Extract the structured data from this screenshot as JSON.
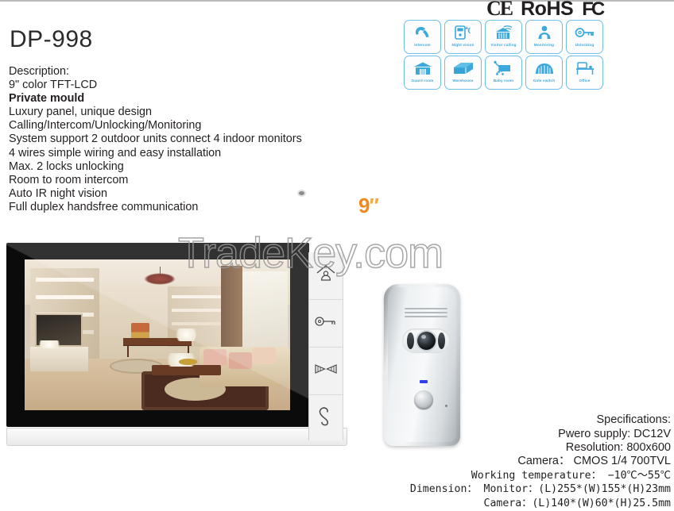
{
  "certifications": [
    {
      "name": "ce-mark",
      "label": "CΕ"
    },
    {
      "name": "rohs-mark",
      "label": "RoHS"
    },
    {
      "name": "fc-mark",
      "label": "FC"
    }
  ],
  "product": {
    "model": "DP-998",
    "size_badge_number": "9",
    "size_badge_unit": "″",
    "description_lines": [
      "Description:",
      "9\" color TFT-LCD",
      "Private mould",
      "Luxury panel, unique design",
      "Calling/Intercom/Unlocking/Monitoring",
      "System support 2 outdoor units connect 4 indoor monitors",
      "4 wires simple wiring and easy installation",
      "Max. 2 locks unlocking",
      "Room to room intercom",
      "Auto IR night vision",
      "Full duplex handsfree communication"
    ],
    "bold_line_index": 2
  },
  "features": [
    {
      "icon": "handset-icon",
      "label": "Intercom"
    },
    {
      "icon": "night-vision-icon",
      "label": "Night vision"
    },
    {
      "icon": "visitor-calling-icon",
      "label": "Visitor calling"
    },
    {
      "icon": "person-monitoring-icon",
      "label": "Monitoring"
    },
    {
      "icon": "key-icon",
      "label": "Unlocking"
    },
    {
      "icon": "guard-room-icon",
      "label": "Guard  room"
    },
    {
      "icon": "warehouse-icon",
      "label": "Warehouse"
    },
    {
      "icon": "baby-room-icon",
      "label": "Baby room"
    },
    {
      "icon": "gate-switch-icon",
      "label": "Gate switch"
    },
    {
      "icon": "office-desk-icon",
      "label": "Office"
    }
  ],
  "monitor_keys": [
    {
      "icon": "monitor-person-icon",
      "name": "monitor-key"
    },
    {
      "icon": "key-icon",
      "name": "unlock-key"
    },
    {
      "icon": "gate-icon",
      "name": "gate-key"
    },
    {
      "icon": "handset-icon",
      "name": "talk-key"
    }
  ],
  "watermark": {
    "text": "TradeKey.com"
  },
  "specifications": {
    "heading": "Specifications:",
    "lines": [
      "Pwero supply: DC12V",
      "Resolution: 800x600",
      "Camera： CMOS 1/4 700TVL",
      "Working temperature： −10℃～55℃",
      "Dimension： Monitor：(L)255*(W)155*(H)23mm",
      "Camera：(L)140*(W)60*(H)25.5mm"
    ]
  },
  "colors": {
    "feature_blue": "#3ba9dc",
    "feature_border": "#6ec0e8",
    "badge_orange": "#ef8a1b",
    "text_dark": "#231f20",
    "led_blue": "#2b3ff0"
  }
}
